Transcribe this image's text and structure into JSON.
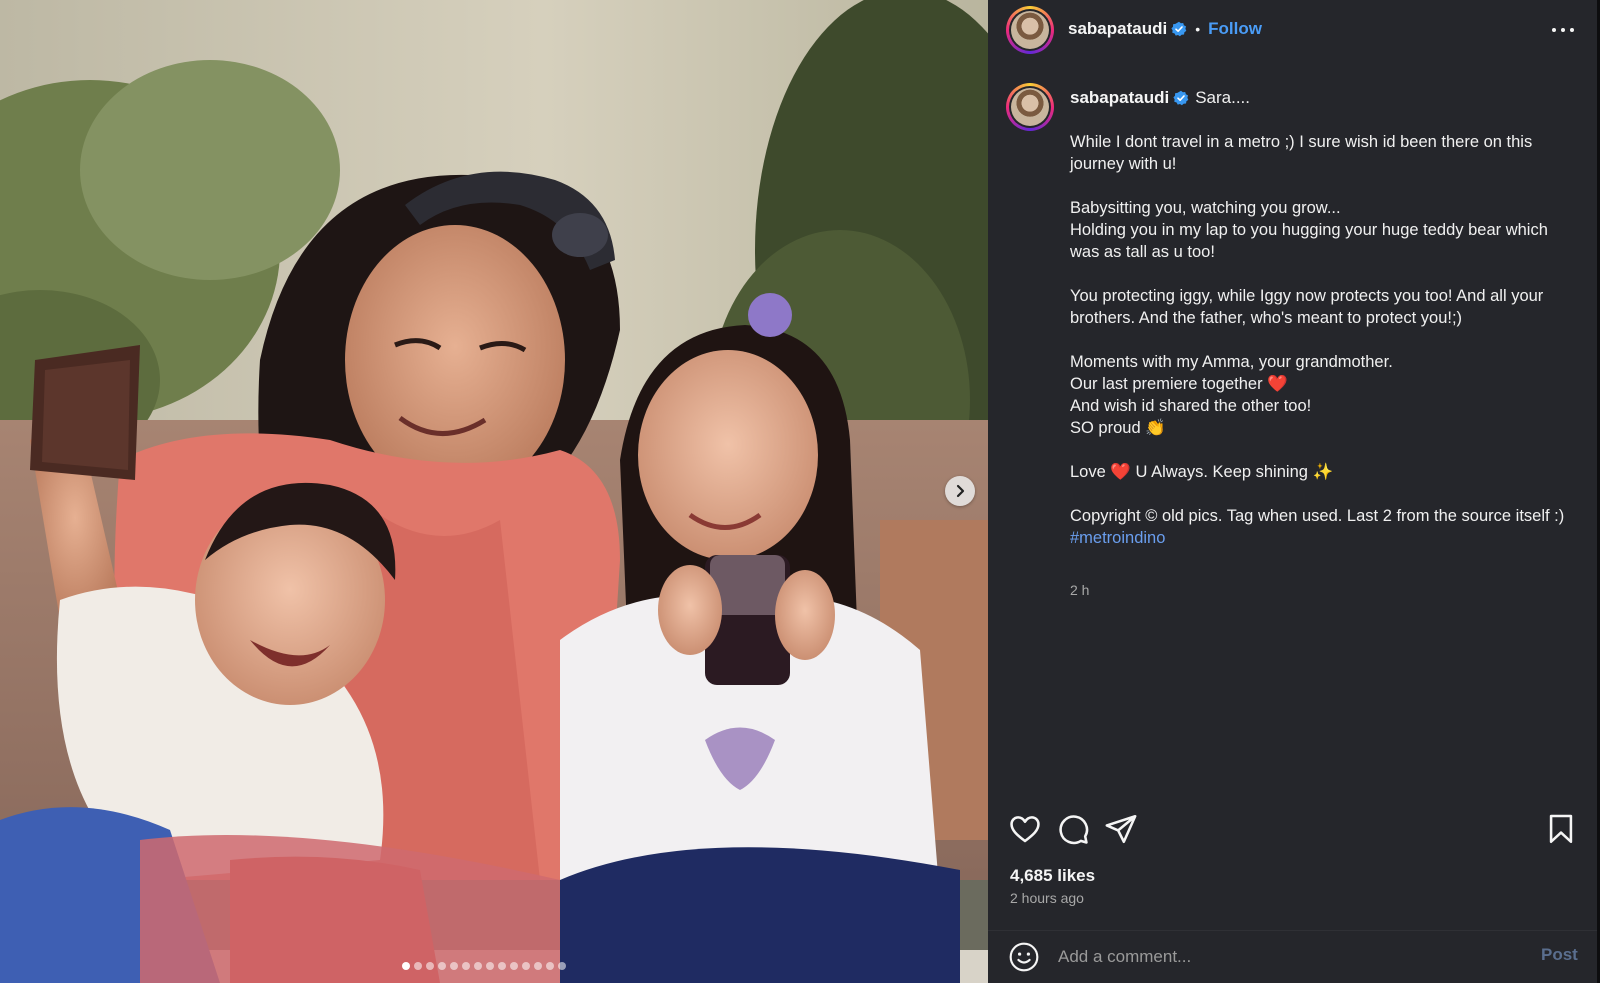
{
  "post": {
    "username": "sabapataudi",
    "verified": true,
    "separator": "•",
    "follow_label": "Follow",
    "caption_title": "Sara....",
    "caption_paragraphs": [
      [
        "While I dont travel in a metro ;) I sure wish id been there on this journey with u!"
      ],
      [
        "Babysitting you, watching you grow...",
        "Holding you in my lap to you hugging your huge teddy bear which was as tall as u too!"
      ],
      [
        "You protecting iggy, while Iggy now protects you too! And all your brothers. And the father, who's meant to protect you!;)"
      ],
      [
        "Moments with my Amma, your grandmother.",
        "Our last premiere together ❤️",
        "And wish id shared the other too!",
        "SO proud 👏"
      ],
      [
        "Love ❤️ U Always. Keep shining ✨"
      ],
      [
        "Copyright © old pics. Tag when used. Last 2 from the source itself :)"
      ]
    ],
    "hashtag": "#metroindino",
    "time_short": "2 h",
    "likes": "4,685 likes",
    "time_ago": "2 hours ago",
    "comment": {
      "placeholder": "Add a comment...",
      "value": "",
      "post_label": "Post"
    }
  },
  "media": {
    "total_slides": 14,
    "current_slide": 1,
    "next_icon": "chevron-right-icon"
  },
  "icons": {
    "verified": "verified-badge-icon",
    "more": "more-horizontal-icon",
    "like": "heart-icon",
    "comment": "comment-icon",
    "share": "send-icon",
    "save": "bookmark-icon",
    "emoji": "emoji-icon"
  },
  "colors": {
    "panel_bg": "#25262b",
    "link_blue": "#4a9cf6",
    "hashtag": "#6a9eee",
    "muted": "#a8a8a8",
    "post_disabled": "#5a6e8e",
    "verified_blue": "#3897f0"
  }
}
